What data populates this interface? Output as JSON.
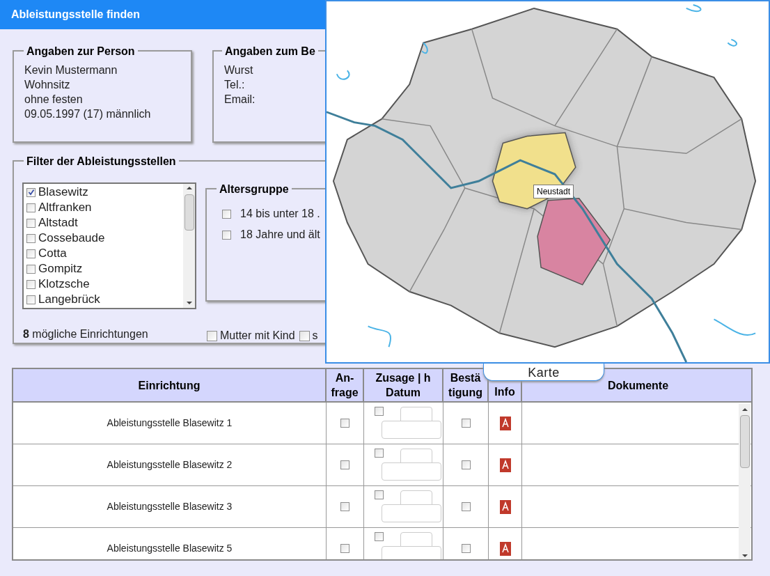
{
  "window": {
    "title": "Ableistungsstelle finden"
  },
  "person": {
    "legend": "Angaben zur Person",
    "lines": [
      "Kevin Mustermann",
      "Wohnsitz",
      "ohne festen",
      "09.05.1997 (17) männlich"
    ]
  },
  "contact": {
    "legend": "Angaben zum Be",
    "lines": [
      "Wurst",
      "Tel.:",
      "Email:"
    ]
  },
  "filter": {
    "legend": "Filter der Ableistungsstellen",
    "districts": [
      {
        "label": "Blasewitz",
        "checked": true
      },
      {
        "label": "Altfranken",
        "checked": false
      },
      {
        "label": "Altstadt",
        "checked": false
      },
      {
        "label": "Cossebaude",
        "checked": false
      },
      {
        "label": "Cotta",
        "checked": false
      },
      {
        "label": "Gompitz",
        "checked": false
      },
      {
        "label": "Klotzsche",
        "checked": false
      },
      {
        "label": "Langebrück",
        "checked": false
      }
    ],
    "age_group": {
      "legend": "Altersgruppe",
      "options": [
        {
          "label": "14 bis unter 18 .",
          "checked": false
        },
        {
          "label": "18 Jahre und ält",
          "checked": false
        }
      ]
    },
    "count": "**8** mögliche Einrichtungen",
    "extras": [
      {
        "label": "Mutter mit Kind",
        "checked": false
      },
      {
        "label": "s",
        "checked": false
      }
    ]
  },
  "map": {
    "tooltip": "Neustadt",
    "tab": "Karte"
  },
  "table": {
    "columns": [
      {
        "lines": [
          "Einrichtung"
        ]
      },
      {
        "lines": [
          "An-",
          "frage"
        ]
      },
      {
        "lines": [
          "Zusage | h",
          "Datum"
        ]
      },
      {
        "lines": [
          "Bestä",
          "tigung"
        ]
      },
      {
        "lines": [
          "Info"
        ]
      },
      {
        "lines": [
          "Dokumente"
        ]
      }
    ],
    "rows": [
      {
        "name": "Ableistungsstelle Blasewitz 1",
        "request": false,
        "commitment": false,
        "confirmation": false
      },
      {
        "name": "Ableistungsstelle Blasewitz 2",
        "request": false,
        "commitment": false,
        "confirmation": false
      },
      {
        "name": "Ableistungsstelle Blasewitz 3",
        "request": false,
        "commitment": false,
        "confirmation": false
      },
      {
        "name": "Ableistungsstelle Blasewitz 5",
        "request": false,
        "commitment": false,
        "confirmation": false
      }
    ]
  }
}
